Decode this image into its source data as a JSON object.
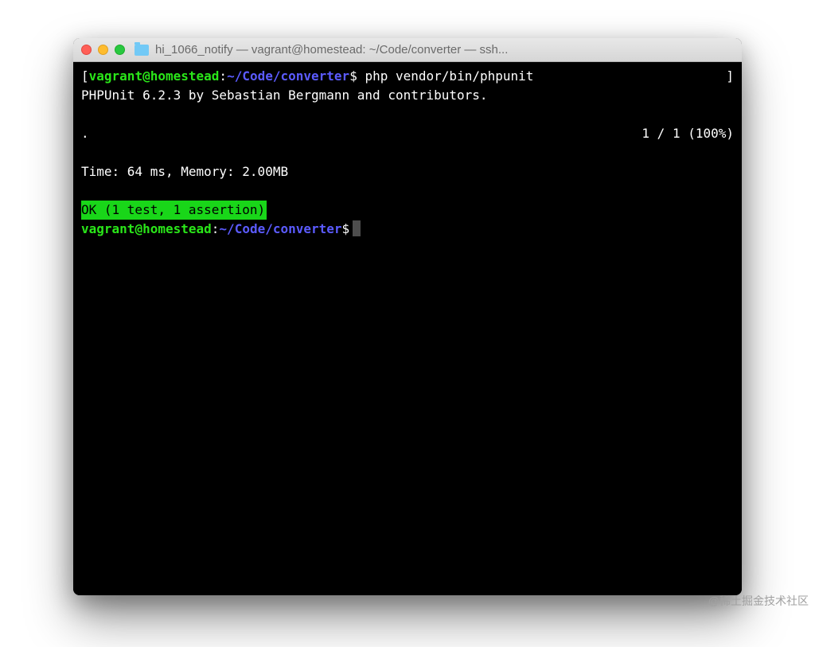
{
  "titlebar": {
    "title": "hi_1066_notify — vagrant@homestead: ~/Code/converter — ssh..."
  },
  "prompt": {
    "open_bracket": "[",
    "user": "vagrant",
    "at": "@",
    "host": "homestead",
    "colon": ":",
    "path": "~/Code/converter",
    "dollar": "$",
    "close_bracket": "]"
  },
  "command": "php vendor/bin/phpunit",
  "output": {
    "header": "PHPUnit 6.2.3 by Sebastian Bergmann and contributors.",
    "dot": ".",
    "progress": "1 / 1 (100%)",
    "stats": "Time: 64 ms, Memory: 2.00MB",
    "ok": "OK (1 test, 1 assertion)"
  },
  "watermark": "@稀土掘金技术社区"
}
